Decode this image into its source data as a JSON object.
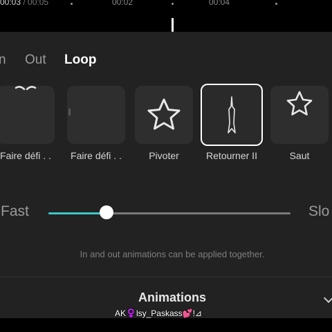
{
  "timeline": {
    "current": "00:03",
    "separator": " / ",
    "total": "00:05",
    "ticks": [
      "00:02",
      "00:04"
    ]
  },
  "tabs": [
    "n",
    "Out",
    "Loop"
  ],
  "active_tab": "Loop",
  "presets": [
    {
      "label": "Faire défi . .",
      "icon": "scroll-icon"
    },
    {
      "label": "Faire défi . .",
      "icon": "scroll-icon"
    },
    {
      "label": "Pivoter",
      "icon": "star-icon"
    },
    {
      "label": "Retourner II",
      "icon": "flip-icon",
      "selected": true
    },
    {
      "label": "Saut",
      "icon": "star-icon"
    }
  ],
  "speed": {
    "fast_label": "Fast",
    "slow_label": "Slo",
    "value": 0.24,
    "accent": "#3cc7c9"
  },
  "hint": "In and out animations can be applied together.",
  "bottom_title": "Animations",
  "watermark": "AK♀️‎lsy_Paskass💕!⊿"
}
